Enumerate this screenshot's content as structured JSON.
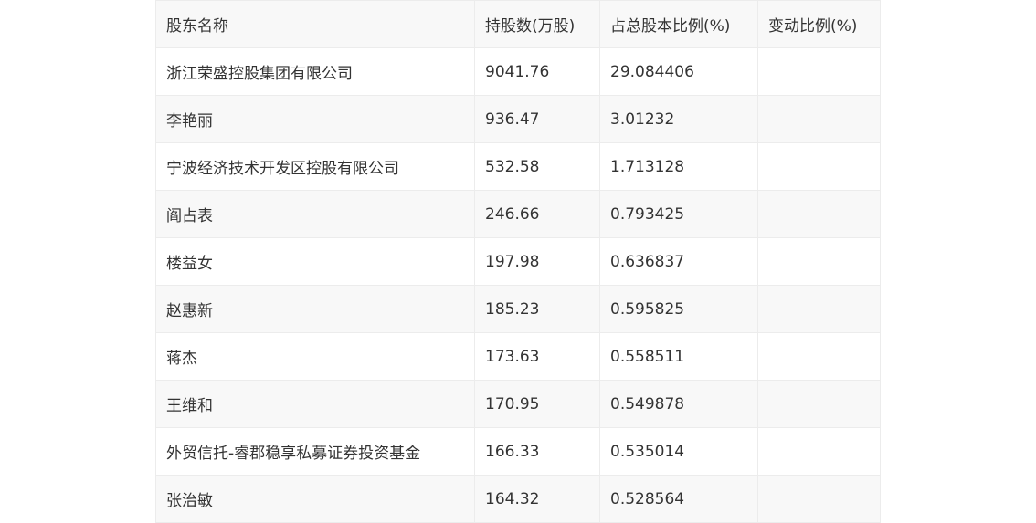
{
  "table": {
    "headers": [
      "股东名称",
      "持股数(万股)",
      "占总股本比例(%)",
      "变动比例(%)"
    ],
    "rows": [
      [
        "浙江荣盛控股集团有限公司",
        "9041.76",
        "29.084406",
        ""
      ],
      [
        "李艳丽",
        "936.47",
        "3.01232",
        ""
      ],
      [
        "宁波经济技术开发区控股有限公司",
        "532.58",
        "1.713128",
        ""
      ],
      [
        "阎占表",
        "246.66",
        "0.793425",
        ""
      ],
      [
        "楼益女",
        "197.98",
        "0.636837",
        ""
      ],
      [
        "赵惠新",
        "185.23",
        "0.595825",
        ""
      ],
      [
        "蒋杰",
        "173.63",
        "0.558511",
        ""
      ],
      [
        "王维和",
        "170.95",
        "0.549878",
        ""
      ],
      [
        "外贸信托-睿郡稳享私募证券投资基金",
        "166.33",
        "0.535014",
        ""
      ],
      [
        "张治敏",
        "164.32",
        "0.528564",
        ""
      ]
    ]
  }
}
